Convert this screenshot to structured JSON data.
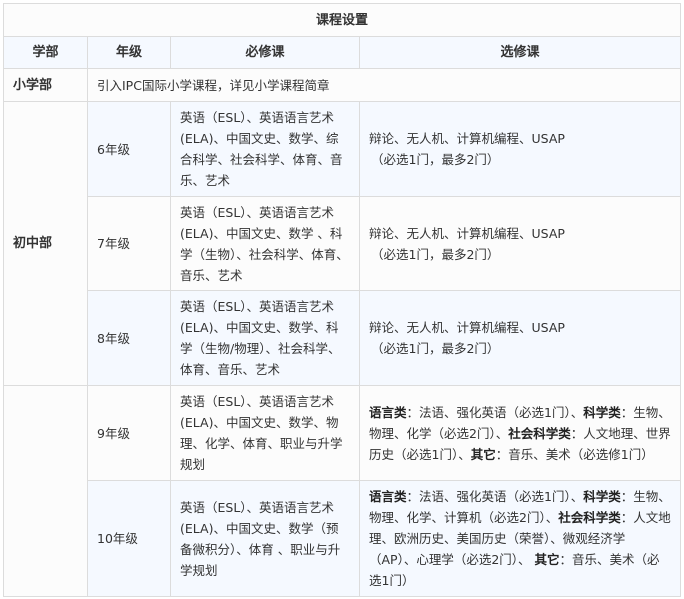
{
  "title": "课程设置",
  "headers": [
    "学部",
    "年级",
    "必修课",
    "选修课"
  ],
  "primary": {
    "department": "小学部",
    "description": "引入IPC国际小学课程，详见小学课程简章"
  },
  "middle": {
    "department": "初中部",
    "rows": [
      {
        "grade": "6年级",
        "required": "英语（ESL）、英语语言艺术(ELA)、中国文史、数学、综合科学、社会科学、体育、音乐、艺术",
        "elective": "辩论、无人机、计算机编程、USAP",
        "elective_note": "（必选1门，最多2门）"
      },
      {
        "grade": "7年级",
        "required": "英语（ESL）、英语语言艺术(ELA)、中国文史、数学 、科学（生物）、社会科学、体育、音乐、艺术",
        "elective": "辩论、无人机、计算机编程、USAP",
        "elective_note": "（必选1门，最多2门）"
      },
      {
        "grade": "8年级",
        "required": "英语（ESL）、英语语言艺术(ELA)、中国文史、数学、科学（生物/物理）、社会科学、体育、音乐、艺术",
        "elective": "辩论、无人机、计算机编程、USAP",
        "elective_note": "（必选1门，最多2门）"
      }
    ]
  },
  "high": {
    "rows": [
      {
        "grade": "9年级",
        "required": "英语（ESL）、英语语言艺术(ELA)、中国文史、数学、物理、化学、体育、职业与升学规划",
        "elective_parts": [
          {
            "label": "语言类",
            "text": "：法语、强化英语（必选1门）、"
          },
          {
            "label": "科学类",
            "text": "：生物、物理、化学（必选2门）、"
          },
          {
            "label": "社会科学类",
            "text": "：人文地理、世界历史（必选1门）、"
          },
          {
            "label": "其它",
            "text": "：音乐、美术（必选修1门）"
          }
        ]
      },
      {
        "grade": "10年级",
        "required": "英语（ESL）、英语语言艺术(ELA)、中国文史、数学（预备微积分）、体育 、职业与升学规划",
        "elective_parts": [
          {
            "label": "语言类",
            "text": "：法语、强化英语（必选1门）、"
          },
          {
            "label": "科学类",
            "text": "：生物、物理、化学、计算机（必选2门）、"
          },
          {
            "label": "社会科学类",
            "text": "：人文地理、欧洲历史、美国历史（荣誉）、微观经济学（AP）、心理学（必选2门）、 "
          },
          {
            "label": "其它",
            "text": "：音乐、美术（必选1门）"
          }
        ]
      }
    ]
  }
}
